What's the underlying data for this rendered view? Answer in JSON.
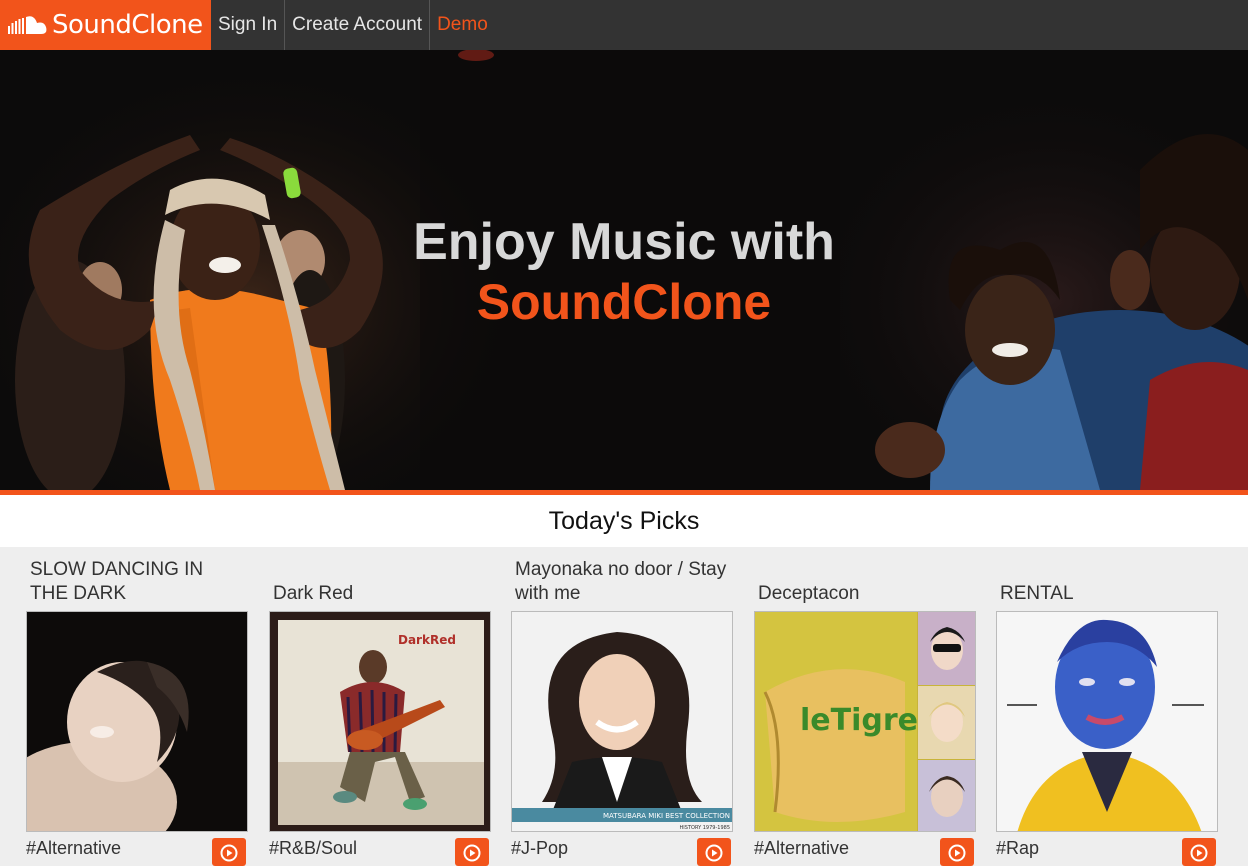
{
  "nav": {
    "logo_text": "SoundClone",
    "sign_in": "Sign In",
    "create_account": "Create Account",
    "demo": "Demo"
  },
  "hero": {
    "line1": "Enjoy Music with",
    "line2": "SoundClone"
  },
  "picks": {
    "title": "Today's Picks",
    "items": [
      {
        "title": "SLOW DANCING IN THE DARK",
        "genre": "#Alternative",
        "cover_icon": "album-cover-slow-dancing"
      },
      {
        "title": "Dark Red",
        "genre": "#R&B/Soul",
        "cover_text": "DarkRed"
      },
      {
        "title": "Mayonaka no door / Stay with me",
        "genre": "#J-Pop",
        "cover_text": "MATSUBARA MIKI BEST COLLECTION",
        "cover_subtext": "HISTORY 1979-1985"
      },
      {
        "title": "Deceptacon",
        "genre": "#Alternative",
        "cover_text": "leTigre"
      },
      {
        "title": "RENTAL",
        "genre": "#Rap",
        "cover_icon": "album-cover-rental"
      }
    ]
  },
  "colors": {
    "brand_orange": "#f2541b",
    "nav_bg": "#333333",
    "hero_text": "#d8d8d8"
  },
  "icons": {
    "logo": "soundcloud-cloud-icon",
    "play": "play-circle-icon"
  }
}
